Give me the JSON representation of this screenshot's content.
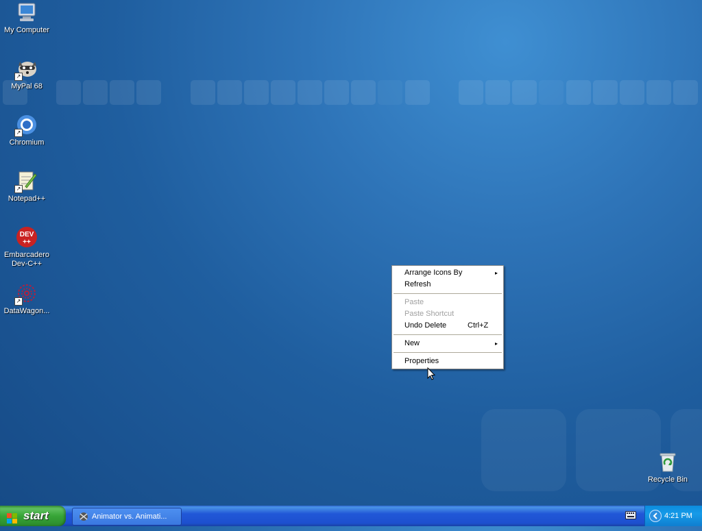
{
  "desktop": {
    "icons": [
      {
        "label": "My Computer",
        "icon": "my-computer-icon"
      },
      {
        "label": "MyPal 68",
        "icon": "mypal-raccoon-icon"
      },
      {
        "label": "Chromium",
        "icon": "chromium-icon"
      },
      {
        "label": "Notepad++",
        "icon": "notepad-plus-plus-icon"
      },
      {
        "label": "Embarcadero Dev-C++",
        "icon": "dev-cpp-icon",
        "badge": "DEV",
        "badge2": "++"
      },
      {
        "label": "DataWagon...",
        "icon": "datawagon-icon"
      },
      {
        "label": "Recycle Bin",
        "icon": "recycle-bin-icon"
      }
    ]
  },
  "context_menu": {
    "items": [
      {
        "label": "Arrange Icons By",
        "submenu": true,
        "enabled": true
      },
      {
        "label": "Refresh",
        "enabled": true
      },
      {
        "label": "Paste",
        "enabled": false
      },
      {
        "label": "Paste Shortcut",
        "enabled": false
      },
      {
        "label": "Undo Delete",
        "accelerator": "Ctrl+Z",
        "enabled": true
      },
      {
        "label": "New",
        "submenu": true,
        "enabled": true
      },
      {
        "label": "Properties",
        "enabled": true
      }
    ],
    "submenu_arrow": "▸"
  },
  "taskbar": {
    "start_label": "start",
    "tasks": [
      {
        "label": "Animator vs. Animati..."
      }
    ],
    "clock": "4:21 PM",
    "colors": {
      "taskbar": "#245edb",
      "start": "#3c9a3c",
      "tray": "#0f8bdf"
    }
  }
}
